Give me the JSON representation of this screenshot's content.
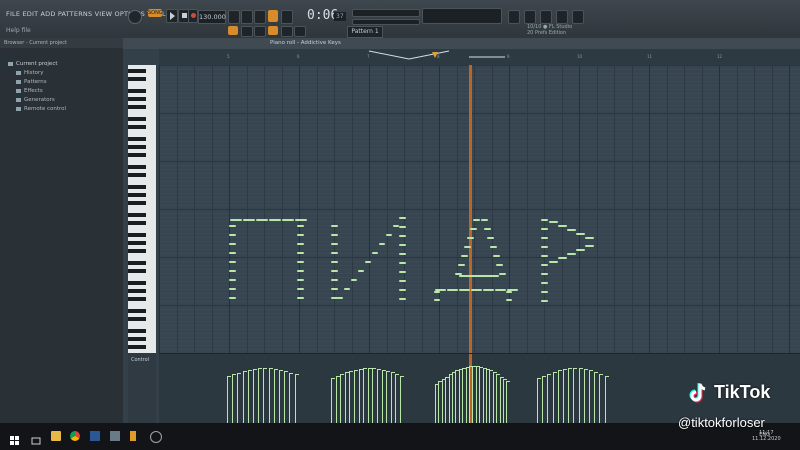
{
  "app": {
    "menu": "FILE EDIT ADD PATTERNS VIEW OPTIONS TOOLS HELP",
    "hint": "Help file",
    "mode_label": "SONG",
    "tempo": "130.000",
    "time": "0:06",
    "time_sub": "37",
    "pattern": "Pattern 1",
    "news_line1": "10/10 ● FL Studio",
    "news_line2": "20 Prefs Edition",
    "colors": {
      "accent": "#d88b2a",
      "note": "#b8e6a8",
      "playhead": "#c86a23"
    }
  },
  "browser": {
    "header": "Browser - Current project",
    "root": "Current project",
    "items": [
      "History",
      "Patterns",
      "Effects",
      "Generators",
      "Remote control"
    ]
  },
  "piano_roll": {
    "title": "Piano roll - Addictive Keys",
    "control_label": "Control",
    "ruler_marks": [
      "5",
      "6",
      "7",
      "8",
      "9",
      "10",
      "11",
      "12"
    ]
  },
  "overlay": {
    "brand": "TikTok",
    "handle": "@tiktokforloser"
  },
  "taskbar": {
    "lang": "ENG",
    "time": "11:17",
    "date": "11.12.2020"
  }
}
